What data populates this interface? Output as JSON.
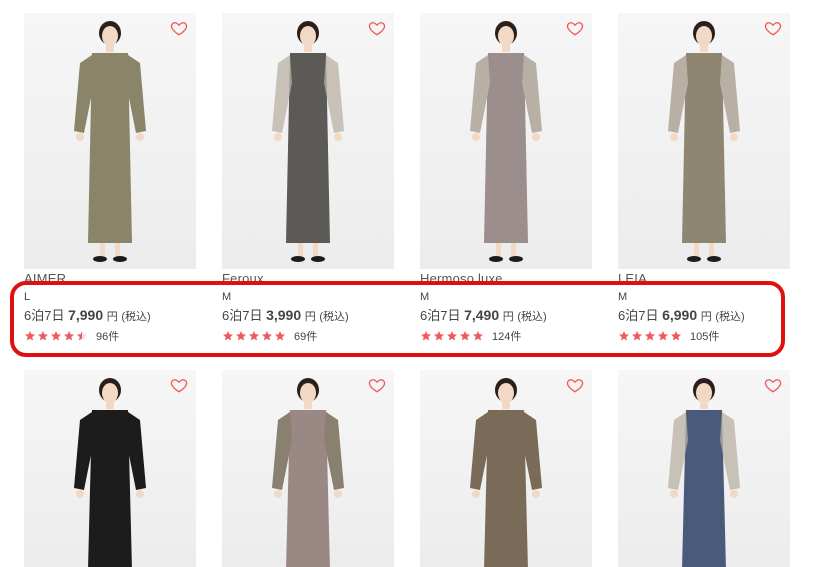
{
  "colors": {
    "accent": "#f05a5a",
    "highlight": "#e01010",
    "star": "#f05a5a"
  },
  "icons": {
    "favorite": "heart-outline-icon",
    "star": "star-icon"
  },
  "products": [
    {
      "brand": "AIMER",
      "size": "L",
      "nights": "6泊7日",
      "price": "7,990",
      "yen": "円",
      "tax": "(税込)",
      "rating": 4.5,
      "reviews": "96件",
      "dress_color": "#8a8468",
      "sleeve": "lace"
    },
    {
      "brand": "Feroux",
      "size": "M",
      "nights": "6泊7日",
      "price": "3,990",
      "yen": "円",
      "tax": "(税込)",
      "rating": 5,
      "reviews": "69件",
      "dress_color": "#5c5a56",
      "sleeve": "sheer"
    },
    {
      "brand": "Hermoso luxe",
      "size": "M",
      "nights": "6泊7日",
      "price": "7,490",
      "yen": "円",
      "tax": "(税込)",
      "rating": 5,
      "reviews": "124件",
      "dress_color": "#9c8e8c",
      "sleeve": "puff"
    },
    {
      "brand": "LEIA",
      "size": "M",
      "nights": "6泊7日",
      "price": "6,990",
      "yen": "円",
      "tax": "(税込)",
      "rating": 5,
      "reviews": "105件",
      "dress_color": "#8e8670",
      "sleeve": "puff"
    },
    {
      "dress_color": "#1c1c1c",
      "sleeve": "lace"
    },
    {
      "dress_color": "#9a8884",
      "sleeve": "fur"
    },
    {
      "dress_color": "#7a6a58",
      "sleeve": "long"
    },
    {
      "dress_color": "#4a5a7a",
      "sleeve": "sheer"
    }
  ]
}
